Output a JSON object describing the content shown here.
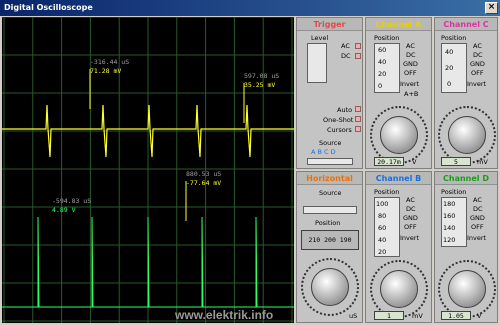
{
  "window": {
    "title": "Digital Oscilloscope",
    "close_glyph": "×"
  },
  "cursor_labels": {
    "c1_time": "-316.44 uS",
    "c1_val": "71.28 mV",
    "c2_time": "597.08 uS",
    "c2_val": "35.25 mV",
    "c3_time": "880.53 uS",
    "c3_val": "-77.64 mV",
    "c4_time": "-594.83 uS",
    "c4_val": "4.89 V"
  },
  "trigger": {
    "title": "Trigger",
    "level": "Level",
    "ac": "AC",
    "dc": "DC",
    "auto": "Auto",
    "oneshot": "One-Shot",
    "cursors": "Cursors",
    "source": "Source",
    "source_letters": "A  B  C  D"
  },
  "channel_a": {
    "title": "Channel A",
    "position": "Position",
    "ac": "AC",
    "dc": "DC",
    "gnd": "GND",
    "off": "OFF",
    "invert": "Invert",
    "aplusb": "A+B",
    "pos_ticks": [
      "60",
      "40",
      "20",
      "0"
    ],
    "readout": "20.17m",
    "unit": "V"
  },
  "channel_c": {
    "title": "Channel C",
    "position": "Position",
    "ac": "AC",
    "dc": "DC",
    "gnd": "GND",
    "off": "OFF",
    "invert": "Invert",
    "pos_ticks": [
      "40",
      "20",
      "0"
    ],
    "readout": "5",
    "unit": "mV"
  },
  "horizontal": {
    "title": "Horizontal",
    "source": "Source",
    "position": "Position",
    "readout": "210  200  190",
    "unit": "uS"
  },
  "channel_b": {
    "title": "Channel B",
    "position": "Position",
    "ac": "AC",
    "dc": "DC",
    "gnd": "GND",
    "off": "OFF",
    "invert": "Invert",
    "pos_ticks": [
      "100",
      "80",
      "60",
      "40",
      "20"
    ],
    "readout": "1",
    "unit": "mV"
  },
  "channel_d": {
    "title": "Channel D",
    "position": "Position",
    "ac": "AC",
    "dc": "DC",
    "gnd": "GND",
    "off": "OFF",
    "invert": "Invert",
    "pos_ticks": [
      "180",
      "160",
      "140",
      "120"
    ],
    "readout": "1.05",
    "unit": "V"
  },
  "watermark": "www.elektrik.info",
  "trace_colors": {
    "a": "#ffff30",
    "d": "#30ff60",
    "grid": "#2a5a2a"
  }
}
